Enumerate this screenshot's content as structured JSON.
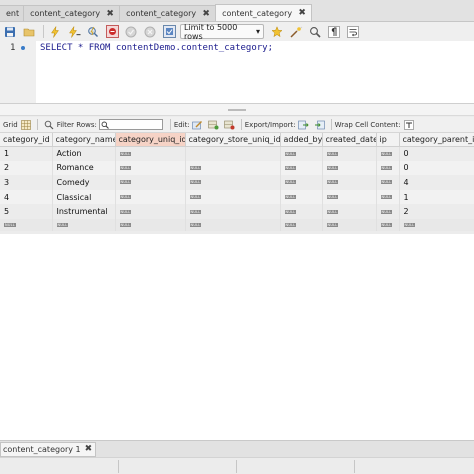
{
  "tabs": [
    {
      "label": "ent",
      "active": false
    },
    {
      "label": "content_category",
      "active": false
    },
    {
      "label": "content_category",
      "active": false
    },
    {
      "label": "content_category",
      "active": true
    }
  ],
  "toolbar": {
    "limit_select": "Limit to 5000 rows",
    "limit_arrow": "▾"
  },
  "editor": {
    "line_number": "1",
    "sql": "SELECT * FROM contentDemo.content_category;"
  },
  "result_toolbar": {
    "grid_label": "Grid",
    "filter_label": "Filter Rows:",
    "filter_value": "",
    "edit_label": "Edit:",
    "export_label": "Export/Import:",
    "wrap_label": "Wrap Cell Content:"
  },
  "grid": {
    "columns": [
      "category_id",
      "category_name",
      "category_uniq_id",
      "category_store_uniq_id",
      "added_by",
      "created_date",
      "ip",
      "category_parent_id"
    ],
    "rows": [
      [
        "1",
        "Action",
        "NULL",
        "",
        "NULL",
        "NULL",
        "NULL",
        "0"
      ],
      [
        "2",
        "Romance",
        "NULL",
        "NULL",
        "NULL",
        "NULL",
        "NULL",
        "0"
      ],
      [
        "3",
        "Comedy",
        "NULL",
        "NULL",
        "NULL",
        "NULL",
        "NULL",
        "4"
      ],
      [
        "4",
        "Classical",
        "NULL",
        "NULL",
        "NULL",
        "NULL",
        "NULL",
        "1"
      ],
      [
        "5",
        "Instrumental",
        "NULL",
        "NULL",
        "NULL",
        "NULL",
        "NULL",
        "2"
      ],
      [
        "NULL",
        "NULL",
        "NULL",
        "NULL",
        "NULL",
        "NULL",
        "NULL",
        "NULL"
      ]
    ]
  },
  "bottom_tab": {
    "label": "content_category 1"
  },
  "colors": {
    "sorted_header": "#f6d3c6",
    "sql_text": "#1a1a8c",
    "null_badge": "#8a8a8a"
  }
}
